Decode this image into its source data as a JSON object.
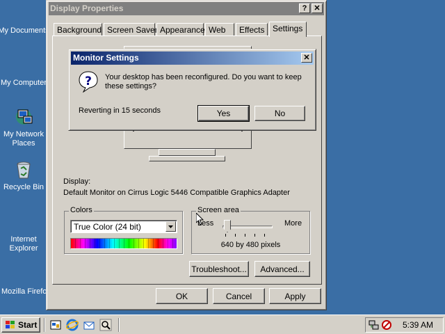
{
  "desktop": {
    "icons": [
      {
        "label": "My Documents",
        "icon": "my-documents-icon"
      },
      {
        "label": "My Computer",
        "icon": "my-computer-icon"
      },
      {
        "label": "My Network Places",
        "icon": "network-icon"
      },
      {
        "label": "Recycle Bin",
        "icon": "recycle-bin-icon"
      },
      {
        "label": "Internet Explorer",
        "icon": "internet-explorer-icon"
      },
      {
        "label": "Mozilla Firefox",
        "icon": "firefox-icon"
      }
    ]
  },
  "window": {
    "title": "Display Properties",
    "help_glyph": "?",
    "close_glyph": "✕",
    "tabs": [
      "Background",
      "Screen Saver",
      "Appearance",
      "Web",
      "Effects",
      "Settings"
    ],
    "active_tab": "Settings",
    "display_label": "Display:",
    "display_value": "Default Monitor on Cirrus Logic 5446 Compatible Graphics Adapter",
    "colors": {
      "label": "Colors",
      "selected": "True Color (24 bit)"
    },
    "screen_area": {
      "label": "Screen area",
      "less": "Less",
      "more": "More",
      "resolution": "640 by 480 pixels",
      "slider_fraction": 0.0
    },
    "troubleshoot": "Troubleshoot...",
    "advanced": "Advanced...",
    "ok": "OK",
    "cancel": "Cancel",
    "apply": "Apply"
  },
  "dialog": {
    "title": "Monitor Settings",
    "close_glyph": "✕",
    "message": "Your desktop has been reconfigured.  Do you want to keep these settings?",
    "countdown": "Reverting in 15 seconds",
    "yes": "Yes",
    "no": "No"
  },
  "taskbar": {
    "start": "Start",
    "quicklaunch": [
      "show-desktop-icon",
      "internet-explorer-icon",
      "outlook-icon",
      "search-icon"
    ],
    "clock": "5:39 AM"
  },
  "colors": {
    "desktop": "#3a6ea5",
    "face": "#d4d0c8",
    "title_active": "#0a246a",
    "title_inactive": "#808080"
  }
}
